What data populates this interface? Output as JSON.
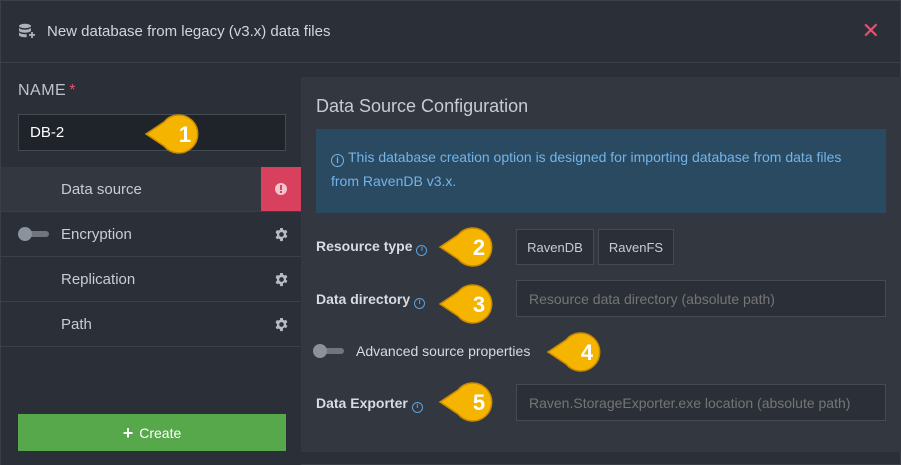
{
  "header": {
    "title": "New database from legacy (v3.x) data files",
    "close_glyph": "✕",
    "icon": "database-add-icon"
  },
  "name_section": {
    "label": "NAME",
    "required_mark": "*",
    "value": "DB-2"
  },
  "steps": [
    {
      "label": "Data source",
      "active": true,
      "side_icon": "alert-icon"
    },
    {
      "label": "Encryption",
      "active": false,
      "side_icon": "gear-icon",
      "has_toggle": true
    },
    {
      "label": "Replication",
      "active": false,
      "side_icon": "gear-icon"
    },
    {
      "label": "Path",
      "active": false,
      "side_icon": "gear-icon"
    }
  ],
  "create_button": {
    "plus": "+",
    "label": "Create"
  },
  "config": {
    "title": "Data Source Configuration",
    "info_icon": "i",
    "info_text": "This database creation option is designed for importing database from data files from RavenDB v3.x.",
    "resource_type": {
      "label": "Resource type",
      "options": [
        "RavenDB",
        "RavenFS"
      ]
    },
    "data_directory": {
      "label": "Data directory",
      "placeholder": "Resource data directory (absolute path)"
    },
    "advanced": {
      "label": "Advanced source properties"
    },
    "data_exporter": {
      "label": "Data Exporter",
      "placeholder": "Raven.StorageExporter.exe location (absolute path)"
    }
  },
  "callouts": [
    "1",
    "2",
    "3",
    "4",
    "5"
  ],
  "colors": {
    "accent_red": "#d7415e",
    "create_green": "#56a84a",
    "info_blue": "#73b4e8",
    "callout_yellow": "#f5b400"
  }
}
